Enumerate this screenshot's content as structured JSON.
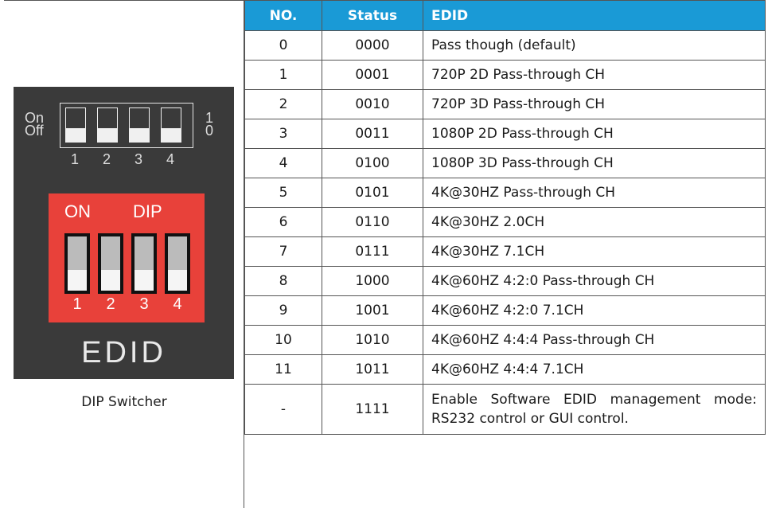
{
  "device": {
    "on_label": "On",
    "off_label": "Off",
    "one_label": "1",
    "zero_label": "0",
    "top_switch_numbers": [
      "1",
      "2",
      "3",
      "4"
    ],
    "red_on_label": "ON",
    "red_dip_label": "DIP",
    "red_switch_numbers": [
      "1",
      "2",
      "3",
      "4"
    ],
    "edid_label": "EDID",
    "colors": {
      "panel": "#3a3a3a",
      "red": "#e8413a"
    }
  },
  "caption": "DIP Switcher",
  "table": {
    "header_color": "#1a9ad6",
    "headers": {
      "no": "NO.",
      "status": "Status",
      "edid": "EDID"
    },
    "rows": [
      {
        "no": "0",
        "status": "0000",
        "edid": "Pass though (default)"
      },
      {
        "no": "1",
        "status": "0001",
        "edid": "720P 2D Pass-through CH"
      },
      {
        "no": "2",
        "status": "0010",
        "edid": "720P 3D Pass-through CH"
      },
      {
        "no": "3",
        "status": "0011",
        "edid": "1080P 2D Pass-through CH"
      },
      {
        "no": "4",
        "status": "0100",
        "edid": "1080P 3D Pass-through CH"
      },
      {
        "no": "5",
        "status": "0101",
        "edid": "4K@30HZ Pass-through CH"
      },
      {
        "no": "6",
        "status": "0110",
        "edid": "4K@30HZ 2.0CH"
      },
      {
        "no": "7",
        "status": "0111",
        "edid": "4K@30HZ 7.1CH"
      },
      {
        "no": "8",
        "status": "1000",
        "edid": "4K@60HZ 4:2:0 Pass-through CH"
      },
      {
        "no": "9",
        "status": "1001",
        "edid": "4K@60HZ 4:2:0 7.1CH"
      },
      {
        "no": "10",
        "status": "1010",
        "edid": "4K@60HZ 4:4:4 Pass-through CH"
      },
      {
        "no": "11",
        "status": "1011",
        "edid": "4K@60HZ 4:4:4 7.1CH"
      },
      {
        "no": "-",
        "status": "1111",
        "edid": "Enable Software EDID management mode: RS232 control or GUI control."
      }
    ]
  }
}
